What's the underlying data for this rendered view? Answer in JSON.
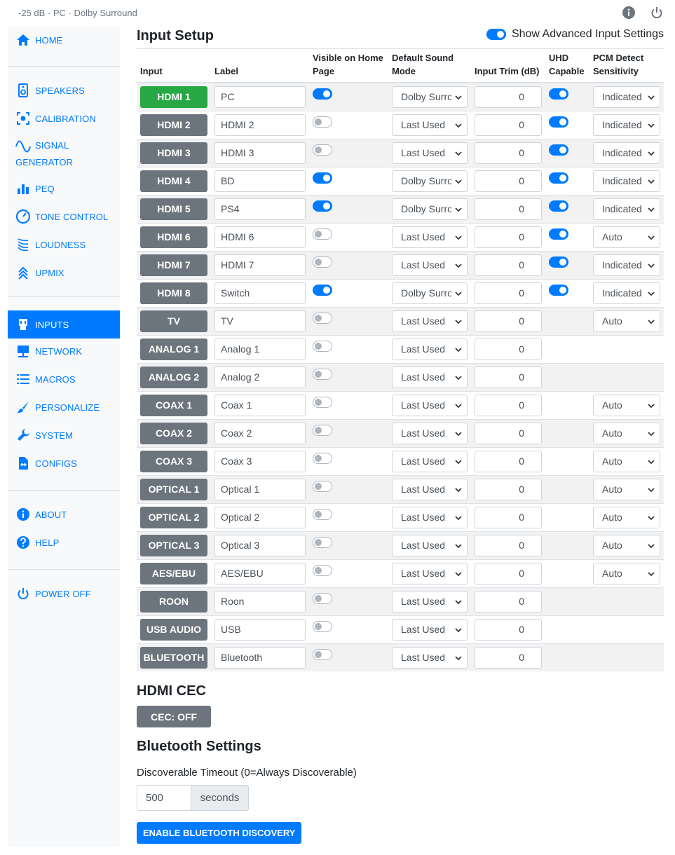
{
  "status": {
    "text": "-25 dB · PC · Dolby Surround"
  },
  "top_icons": [
    "info-icon",
    "power-icon"
  ],
  "sidebar": {
    "items": [
      {
        "label": "HOME",
        "icon": "home-icon"
      },
      {
        "label": "SPEAKERS",
        "icon": "speaker-icon"
      },
      {
        "label": "CALIBRATION",
        "icon": "calibration-icon"
      },
      {
        "label": "SIGNAL GENERATOR",
        "icon": "sine-wave-icon"
      },
      {
        "label": "PEQ",
        "icon": "bar-chart-icon"
      },
      {
        "label": "TONE CONTROL",
        "icon": "gauge-icon"
      },
      {
        "label": "LOUDNESS",
        "icon": "loudness-icon"
      },
      {
        "label": "UPMIX",
        "icon": "upmix-icon"
      },
      {
        "label": "INPUTS",
        "icon": "hdmi-plug-icon"
      },
      {
        "label": "NETWORK",
        "icon": "network-icon"
      },
      {
        "label": "MACROS",
        "icon": "list-icon"
      },
      {
        "label": "PERSONALIZE",
        "icon": "brush-icon"
      },
      {
        "label": "SYSTEM",
        "icon": "wrench-icon"
      },
      {
        "label": "CONFIGS",
        "icon": "file-transfer-icon"
      },
      {
        "label": "ABOUT",
        "icon": "info-icon"
      },
      {
        "label": "HELP",
        "icon": "question-icon"
      },
      {
        "label": "POWER OFF",
        "icon": "power-icon"
      }
    ],
    "active": "INPUTS"
  },
  "input_setup": {
    "title": "Input Setup",
    "advanced_label": "Show Advanced Input Settings",
    "advanced_on": true,
    "columns": {
      "input": "Input",
      "label": "Label",
      "visible": "Visible on Home Page",
      "sound_mode": "Default Sound Mode",
      "trim": "Input Trim (dB)",
      "uhd": "UHD Capable",
      "pcm": "PCM Detect Sensitivity"
    },
    "rows": [
      {
        "input": "HDMI 1",
        "label": "PC",
        "visible": true,
        "mode": "Dolby Surround",
        "trim": "0",
        "uhd": true,
        "pcm": "Indicated",
        "selected": true
      },
      {
        "input": "HDMI 2",
        "label": "HDMI 2",
        "visible": false,
        "mode": "Last Used",
        "trim": "0",
        "uhd": true,
        "pcm": "Indicated"
      },
      {
        "input": "HDMI 3",
        "label": "HDMI 3",
        "visible": false,
        "mode": "Last Used",
        "trim": "0",
        "uhd": true,
        "pcm": "Indicated"
      },
      {
        "input": "HDMI 4",
        "label": "BD",
        "visible": true,
        "mode": "Dolby Surround",
        "trim": "0",
        "uhd": true,
        "pcm": "Indicated"
      },
      {
        "input": "HDMI 5",
        "label": "PS4",
        "visible": true,
        "mode": "Dolby Surround",
        "trim": "0",
        "uhd": true,
        "pcm": "Indicated"
      },
      {
        "input": "HDMI 6",
        "label": "HDMI 6",
        "visible": false,
        "mode": "Last Used",
        "trim": "0",
        "uhd": true,
        "pcm": "Auto"
      },
      {
        "input": "HDMI 7",
        "label": "HDMI 7",
        "visible": false,
        "mode": "Last Used",
        "trim": "0",
        "uhd": true,
        "pcm": "Indicated"
      },
      {
        "input": "HDMI 8",
        "label": "Switch",
        "visible": true,
        "mode": "Dolby Surround",
        "trim": "0",
        "uhd": true,
        "pcm": "Indicated"
      },
      {
        "input": "TV",
        "label": "TV",
        "visible": false,
        "mode": "Last Used",
        "trim": "0",
        "uhd": null,
        "pcm": "Auto"
      },
      {
        "input": "ANALOG 1",
        "label": "Analog 1",
        "visible": false,
        "mode": "Last Used",
        "trim": "0",
        "uhd": null,
        "pcm": null
      },
      {
        "input": "ANALOG 2",
        "label": "Analog 2",
        "visible": false,
        "mode": "Last Used",
        "trim": "0",
        "uhd": null,
        "pcm": null
      },
      {
        "input": "COAX 1",
        "label": "Coax 1",
        "visible": false,
        "mode": "Last Used",
        "trim": "0",
        "uhd": null,
        "pcm": "Auto"
      },
      {
        "input": "COAX 2",
        "label": "Coax 2",
        "visible": false,
        "mode": "Last Used",
        "trim": "0",
        "uhd": null,
        "pcm": "Auto"
      },
      {
        "input": "COAX 3",
        "label": "Coax 3",
        "visible": false,
        "mode": "Last Used",
        "trim": "0",
        "uhd": null,
        "pcm": "Auto"
      },
      {
        "input": "OPTICAL 1",
        "label": "Optical 1",
        "visible": false,
        "mode": "Last Used",
        "trim": "0",
        "uhd": null,
        "pcm": "Auto"
      },
      {
        "input": "OPTICAL 2",
        "label": "Optical 2",
        "visible": false,
        "mode": "Last Used",
        "trim": "0",
        "uhd": null,
        "pcm": "Auto"
      },
      {
        "input": "OPTICAL 3",
        "label": "Optical 3",
        "visible": false,
        "mode": "Last Used",
        "trim": "0",
        "uhd": null,
        "pcm": "Auto"
      },
      {
        "input": "AES/EBU",
        "label": "AES/EBU",
        "visible": false,
        "mode": "Last Used",
        "trim": "0",
        "uhd": null,
        "pcm": "Auto"
      },
      {
        "input": "ROON",
        "label": "Roon",
        "visible": false,
        "mode": "Last Used",
        "trim": "0",
        "uhd": null,
        "pcm": null
      },
      {
        "input": "USB AUDIO",
        "label": "USB",
        "visible": false,
        "mode": "Last Used",
        "trim": "0",
        "uhd": null,
        "pcm": null
      },
      {
        "input": "BLUETOOTH",
        "label": "Bluetooth",
        "visible": false,
        "mode": "Last Used",
        "trim": "0",
        "uhd": null,
        "pcm": null
      }
    ]
  },
  "hdmi_cec": {
    "title": "HDMI CEC",
    "button": "CEC: OFF"
  },
  "bluetooth": {
    "title": "Bluetooth Settings",
    "timeout_label": "Discoverable Timeout (0=Always Discoverable)",
    "timeout_value": "500",
    "timeout_unit": "seconds",
    "discovery_button": "ENABLE BLUETOOTH DISCOVERY"
  },
  "colors": {
    "accent": "#007bff",
    "selected_input": "#28a745",
    "input_button": "#6c757d",
    "sidebar_bg": "#f8f9fa"
  }
}
